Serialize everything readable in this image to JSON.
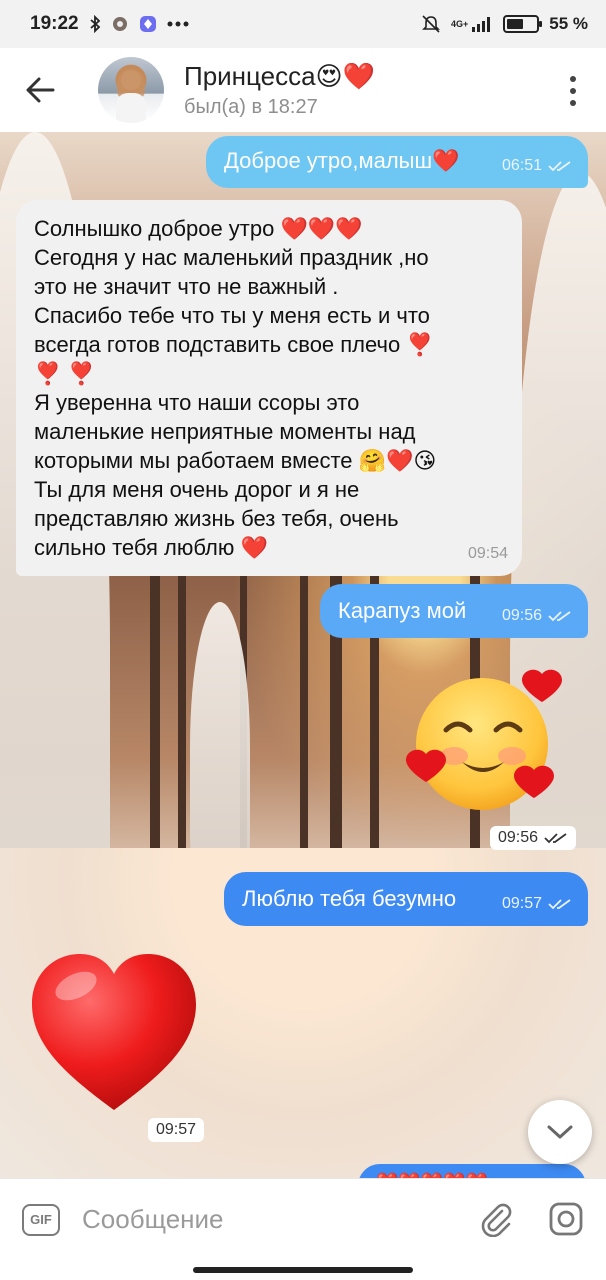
{
  "status_bar": {
    "time": "19:22",
    "network": "4G+",
    "battery": "55 %",
    "battery_level": 0.55
  },
  "header": {
    "contact_name": "Принцесса😍❤️",
    "last_seen": "был(а) в 18:27"
  },
  "messages": [
    {
      "text": "Доброе утро,малыш❤️",
      "time": "06:51",
      "direction": "out"
    },
    {
      "lines": [
        "Солнышко доброе утро ❤️❤️❤️",
        "Сегодня у нас маленький праздник ,но",
        "это не значит что не важный .",
        "Спасибо тебе что ты у меня есть и что",
        "всегда готов подставить свое плечо ❣️",
        "❣️ ❣️",
        "Я уверенна что наши ссоры это",
        "маленькие неприятные моменты над",
        "которыми мы работаем вместе 🤗❤️😘",
        "Ты для меня очень дорог и я не",
        "представляю жизнь без тебя, очень",
        "сильно тебя люблю ❤️"
      ],
      "time": "09:54",
      "direction": "in"
    },
    {
      "text": "Карапуз мой",
      "time": "09:56",
      "direction": "out"
    },
    {
      "sticker": "smiling-face-with-hearts",
      "time": "09:56",
      "direction": "out"
    },
    {
      "text": "Люблю тебя безумно",
      "time": "09:57",
      "direction": "out"
    },
    {
      "sticker": "red-heart",
      "time": "09:57",
      "direction": "in"
    },
    {
      "text": "❤️❤️❤️❤️❤️",
      "direction": "out"
    }
  ],
  "input": {
    "gif_label": "GIF",
    "placeholder": "Сообщение"
  },
  "colors": {
    "outgoing_bubble": "#5aa9f6",
    "incoming_bubble": "#f1f1f1",
    "header_bg": "#ffffff"
  }
}
